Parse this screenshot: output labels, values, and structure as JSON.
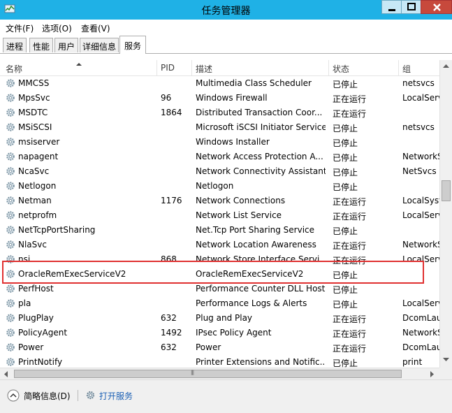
{
  "window": {
    "title": "任务管理器"
  },
  "menu": {
    "file": "文件(F)",
    "options": "选项(O)",
    "view": "查看(V)"
  },
  "tabs": [
    "进程",
    "性能",
    "用户",
    "详细信息",
    "服务"
  ],
  "active_tab": "服务",
  "columns": {
    "name": "名称",
    "pid": "PID",
    "desc": "描述",
    "status": "状态",
    "group": "组"
  },
  "rows": [
    {
      "name": "MMCSS",
      "pid": "",
      "desc": "Multimedia Class Scheduler",
      "status": "已停止",
      "group": "netsvcs"
    },
    {
      "name": "MpsSvc",
      "pid": "96",
      "desc": "Windows Firewall",
      "status": "正在运行",
      "group": "LocalServ"
    },
    {
      "name": "MSDTC",
      "pid": "1864",
      "desc": "Distributed Transaction Coor...",
      "status": "正在运行",
      "group": ""
    },
    {
      "name": "MSiSCSI",
      "pid": "",
      "desc": "Microsoft iSCSI Initiator Service",
      "status": "已停止",
      "group": "netsvcs"
    },
    {
      "name": "msiserver",
      "pid": "",
      "desc": "Windows Installer",
      "status": "已停止",
      "group": ""
    },
    {
      "name": "napagent",
      "pid": "",
      "desc": "Network Access Protection A...",
      "status": "已停止",
      "group": "NetworkS"
    },
    {
      "name": "NcaSvc",
      "pid": "",
      "desc": "Network Connectivity Assistant",
      "status": "已停止",
      "group": "NetSvcs"
    },
    {
      "name": "Netlogon",
      "pid": "",
      "desc": "Netlogon",
      "status": "已停止",
      "group": ""
    },
    {
      "name": "Netman",
      "pid": "1176",
      "desc": "Network Connections",
      "status": "正在运行",
      "group": "LocalSyst"
    },
    {
      "name": "netprofm",
      "pid": "",
      "desc": "Network List Service",
      "status": "正在运行",
      "group": "LocalServ"
    },
    {
      "name": "NetTcpPortSharing",
      "pid": "",
      "desc": "Net.Tcp Port Sharing Service",
      "status": "已停止",
      "group": ""
    },
    {
      "name": "NlaSvc",
      "pid": "",
      "desc": "Network Location Awareness",
      "status": "正在运行",
      "group": "NetworkS"
    },
    {
      "name": "nsi",
      "pid": "868",
      "desc": "Network Store Interface Servi...",
      "status": "正在运行",
      "group": "LocalServ"
    },
    {
      "name": "OracleRemExecServiceV2",
      "pid": "",
      "desc": "OracleRemExecServiceV2",
      "status": "已停止",
      "group": ""
    },
    {
      "name": "PerfHost",
      "pid": "",
      "desc": "Performance Counter DLL Host",
      "status": "已停止",
      "group": ""
    },
    {
      "name": "pla",
      "pid": "",
      "desc": "Performance Logs & Alerts",
      "status": "已停止",
      "group": "LocalServ"
    },
    {
      "name": "PlugPlay",
      "pid": "632",
      "desc": "Plug and Play",
      "status": "正在运行",
      "group": "DcomLau"
    },
    {
      "name": "PolicyAgent",
      "pid": "1492",
      "desc": "IPsec Policy Agent",
      "status": "正在运行",
      "group": "NetworkS"
    },
    {
      "name": "Power",
      "pid": "632",
      "desc": "Power",
      "status": "正在运行",
      "group": "DcomLau"
    },
    {
      "name": "PrintNotify",
      "pid": "",
      "desc": "Printer Extensions and Notific...",
      "status": "已停止",
      "group": "print"
    }
  ],
  "footer": {
    "less_details": "简略信息(D)",
    "open_services": "打开服务"
  },
  "colors": {
    "titlebar": "#1fb1e6",
    "highlight": "#e03030",
    "link": "#1a5fb4"
  }
}
